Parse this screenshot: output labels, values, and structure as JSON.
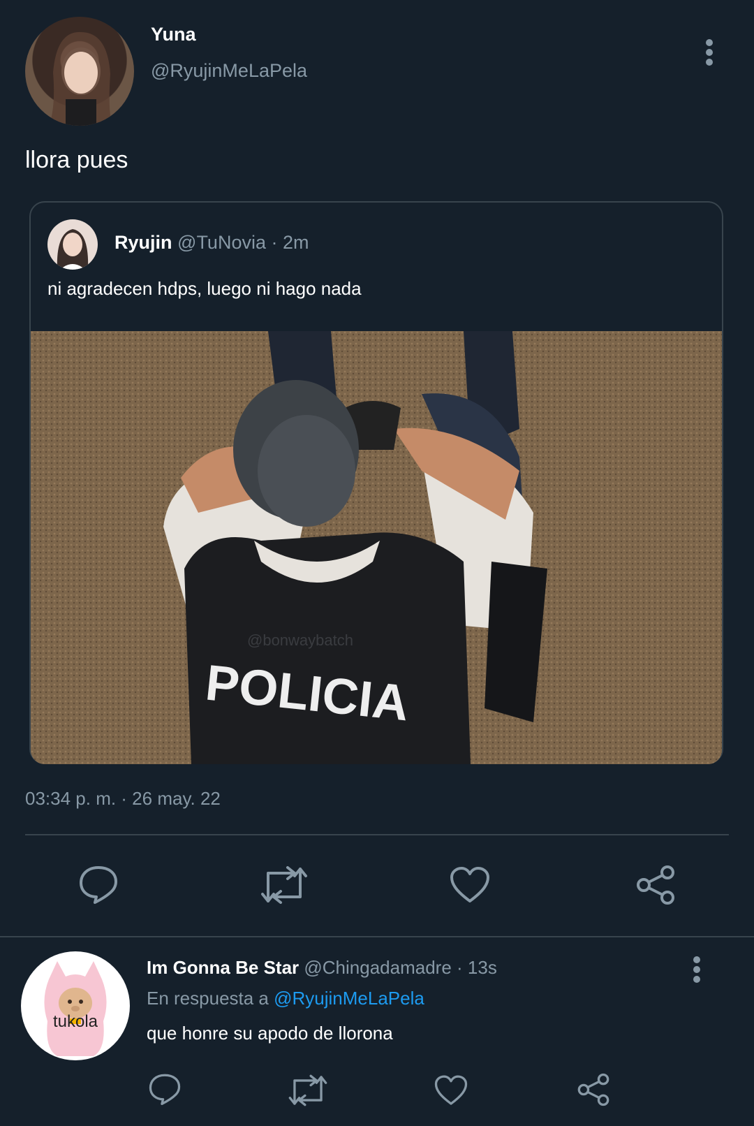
{
  "main_tweet": {
    "display_name": "Yuna",
    "handle": "@RyujinMeLaPela",
    "text": "llora pues",
    "timestamp": "03:34 p. m. · 26 may. 22"
  },
  "quoted_tweet": {
    "display_name": "Ryujin",
    "handle": "@TuNovia",
    "time": "· 2m",
    "text": "ni agradecen hdps, luego ni hago nada",
    "image": {
      "vest_text": "POLICIA",
      "watermark": "@bonwaybatch"
    }
  },
  "actions": [
    "reply-icon",
    "retweet-icon",
    "like-icon",
    "share-icon"
  ],
  "reply": {
    "display_name": "Im Gonna Be Star",
    "handle": "@Chingadamadre",
    "time": "· 13s",
    "replying_prefix": "En respuesta a",
    "replying_handle": "@RyujinMeLaPela",
    "text": "que honre su apodo de llorona",
    "avatar_text": "tukola"
  },
  "colors": {
    "background": "#15202b",
    "muted": "#8899a6",
    "link": "#1d9bf0",
    "divider": "#38444d"
  }
}
